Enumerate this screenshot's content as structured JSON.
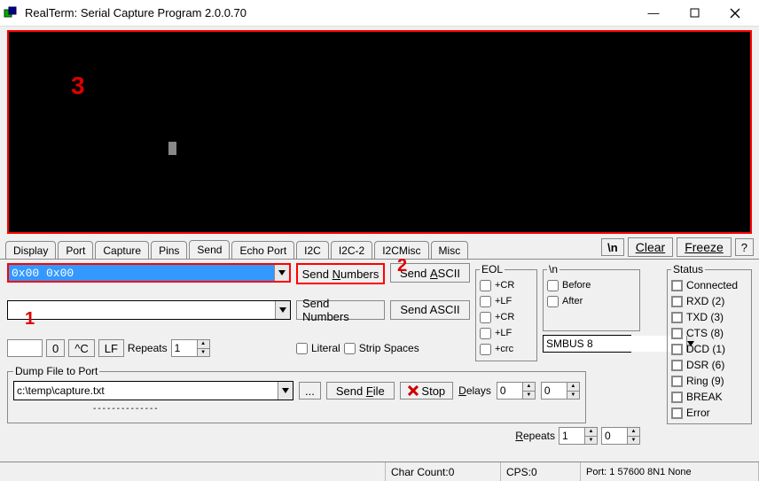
{
  "window": {
    "title": "RealTerm: Serial Capture Program 2.0.0.70"
  },
  "annotations": {
    "a1": "1",
    "a2": "2",
    "a3": "3"
  },
  "tabs": [
    "Display",
    "Port",
    "Capture",
    "Pins",
    "Send",
    "Echo Port",
    "I2C",
    "I2C-2",
    "I2CMisc",
    "Misc"
  ],
  "tab_tools": {
    "nl": "\\n",
    "clear": "Clear",
    "freeze": "Freeze",
    "help": "?"
  },
  "send": {
    "input1": "0x00 0x00",
    "input2": "",
    "send_numbers": "Send Numbers",
    "send_ascii": "Send ASCII",
    "btn_0": "0",
    "btn_hatC": "^C",
    "btn_LF": "LF",
    "repeats_label": "Repeats",
    "repeats_value": "1",
    "literal": "Literal",
    "strip_spaces": "Strip Spaces"
  },
  "eol": {
    "legend": "EOL",
    "items": [
      "+CR",
      "+LF",
      "+CR",
      "+LF",
      "+crc"
    ],
    "smbus": "SMBUS 8"
  },
  "nl": {
    "legend": "\\n",
    "before": "Before",
    "after": "After"
  },
  "dump": {
    "legend": "Dump File to Port",
    "path": "c:\\temp\\capture.txt",
    "browse": "...",
    "send_file": "Send File",
    "stop": "Stop",
    "delays_label": "Delays",
    "delay1": "0",
    "delay2": "0",
    "repeats_label": "Repeats",
    "repeats_value": "1",
    "repeat2": "0"
  },
  "status": {
    "legend": "Status",
    "items": [
      "Connected",
      "RXD (2)",
      "TXD (3)",
      "CTS (8)",
      "DCD (1)",
      "DSR (6)",
      "Ring (9)",
      "BREAK",
      "Error"
    ]
  },
  "statusbar": {
    "char_count": "Char Count:0",
    "cps": "CPS:0",
    "port": "Port: 1 57600 8N1 None"
  }
}
